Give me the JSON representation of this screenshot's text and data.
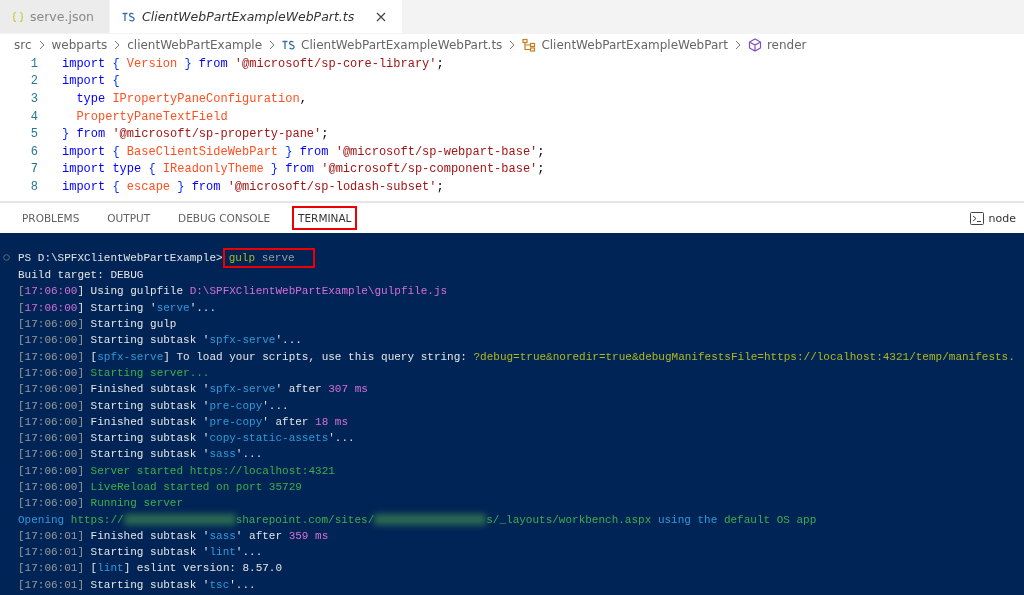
{
  "editor_tabs": [
    {
      "label": "serve.json",
      "kind": "json",
      "selected": false,
      "italic": false,
      "closable": false
    },
    {
      "label": "ClientWebPartExampleWebPart.ts",
      "kind": "ts",
      "selected": true,
      "italic": true,
      "closable": true
    }
  ],
  "breadcrumb": [
    {
      "label": "src",
      "kind": "folder"
    },
    {
      "label": "webparts",
      "kind": "folder"
    },
    {
      "label": "clientWebPartExample",
      "kind": "folder"
    },
    {
      "label": "ClientWebPartExampleWebPart.ts",
      "kind": "ts"
    },
    {
      "label": "ClientWebPartExampleWebPart",
      "kind": "class"
    },
    {
      "label": "render",
      "kind": "method"
    }
  ],
  "code_lines": [
    {
      "number": "1",
      "segments": [
        {
          "text": "import",
          "kind": "keyword"
        },
        {
          "text": " {",
          "kind": "brace"
        },
        {
          "text": " Version ",
          "kind": "ident"
        },
        {
          "text": "}",
          "kind": "brace"
        },
        {
          "text": " from ",
          "kind": "keyword"
        },
        {
          "text": "'@microsoft/sp-core-library'",
          "kind": "string"
        },
        {
          "text": ";",
          "kind": "plain"
        }
      ]
    },
    {
      "number": "2",
      "segments": [
        {
          "text": "import",
          "kind": "keyword"
        },
        {
          "text": " {",
          "kind": "brace"
        }
      ]
    },
    {
      "number": "3",
      "segments": [
        {
          "text": "  type",
          "kind": "keyword"
        },
        {
          "text": " IPropertyPaneConfiguration",
          "kind": "ident"
        },
        {
          "text": ",",
          "kind": "plain"
        }
      ]
    },
    {
      "number": "4",
      "segments": [
        {
          "text": "  PropertyPaneTextField",
          "kind": "ident"
        }
      ]
    },
    {
      "number": "5",
      "segments": [
        {
          "text": "}",
          "kind": "brace"
        },
        {
          "text": " from ",
          "kind": "keyword"
        },
        {
          "text": "'@microsoft/sp-property-pane'",
          "kind": "string"
        },
        {
          "text": ";",
          "kind": "plain"
        }
      ]
    },
    {
      "number": "6",
      "segments": [
        {
          "text": "import",
          "kind": "keyword"
        },
        {
          "text": " {",
          "kind": "brace"
        },
        {
          "text": " BaseClientSideWebPart ",
          "kind": "ident"
        },
        {
          "text": "}",
          "kind": "brace"
        },
        {
          "text": " from ",
          "kind": "keyword"
        },
        {
          "text": "'@microsoft/sp-webpart-base'",
          "kind": "string"
        },
        {
          "text": ";",
          "kind": "plain"
        }
      ]
    },
    {
      "number": "7",
      "segments": [
        {
          "text": "import type",
          "kind": "keyword"
        },
        {
          "text": " {",
          "kind": "brace"
        },
        {
          "text": " IReadonlyTheme ",
          "kind": "ident"
        },
        {
          "text": "}",
          "kind": "brace"
        },
        {
          "text": " from ",
          "kind": "keyword"
        },
        {
          "text": "'@microsoft/sp-component-base'",
          "kind": "string"
        },
        {
          "text": ";",
          "kind": "plain"
        }
      ]
    },
    {
      "number": "8",
      "segments": [
        {
          "text": "import",
          "kind": "keyword"
        },
        {
          "text": " {",
          "kind": "brace"
        },
        {
          "text": " escape ",
          "kind": "ident"
        },
        {
          "text": "}",
          "kind": "brace"
        },
        {
          "text": " from ",
          "kind": "keyword"
        },
        {
          "text": "'@microsoft/sp-lodash-subset'",
          "kind": "string"
        },
        {
          "text": ";",
          "kind": "plain"
        }
      ]
    }
  ],
  "panel_tabs": [
    {
      "label": "PROBLEMS",
      "selected": false,
      "highlighted": false
    },
    {
      "label": "OUTPUT",
      "selected": false,
      "highlighted": false
    },
    {
      "label": "DEBUG CONSOLE",
      "selected": false,
      "highlighted": false
    },
    {
      "label": "TERMINAL",
      "selected": true,
      "highlighted": true
    }
  ],
  "terminal_profile": {
    "label": "node"
  },
  "terminal": {
    "prompt": "PS D:\\SPFXClientWebPartExample>",
    "command": [
      {
        "text": "gulp",
        "kind": "yellow"
      },
      {
        "text": " serve",
        "kind": "gray"
      }
    ],
    "command_highlighted": true,
    "lines": [
      [
        {
          "text": "Build target: DEBUG",
          "kind": "plain"
        }
      ],
      [
        {
          "text": "[",
          "kind": "gray"
        },
        {
          "text": "17:06:00",
          "kind": "magenta"
        },
        {
          "text": "] Using gulpfile ",
          "kind": "plain"
        },
        {
          "text": "D:\\SPFXClientWebPartExample\\gulpfile.js",
          "kind": "magenta"
        }
      ],
      [
        {
          "text": "[",
          "kind": "gray"
        },
        {
          "text": "17:06:00",
          "kind": "magenta"
        },
        {
          "text": "] Starting '",
          "kind": "plain"
        },
        {
          "text": "serve",
          "kind": "cyan"
        },
        {
          "text": "'...",
          "kind": "plain"
        }
      ],
      [
        {
          "text": "[17:06:00]",
          "kind": "gray"
        },
        {
          "text": " Starting gulp",
          "kind": "plain"
        }
      ],
      [
        {
          "text": "[17:06:00]",
          "kind": "gray"
        },
        {
          "text": " Starting subtask '",
          "kind": "plain"
        },
        {
          "text": "spfx-serve",
          "kind": "cyan"
        },
        {
          "text": "'...",
          "kind": "plain"
        }
      ],
      [
        {
          "text": "[17:06:00]",
          "kind": "gray"
        },
        {
          "text": " [",
          "kind": "plain"
        },
        {
          "text": "spfx-serve",
          "kind": "cyan"
        },
        {
          "text": "] To load your scripts, use this query string: ",
          "kind": "plain"
        },
        {
          "text": "?debug=true&noredir=true&debugManifestsFile=https://localhost:4321/temp/manifests.",
          "kind": "yellow"
        }
      ],
      [
        {
          "text": "[17:06:00]",
          "kind": "gray"
        },
        {
          "text": " Starting server...",
          "kind": "green"
        }
      ],
      [
        {
          "text": "[17:06:00]",
          "kind": "gray"
        },
        {
          "text": " Finished subtask '",
          "kind": "plain"
        },
        {
          "text": "spfx-serve",
          "kind": "cyan"
        },
        {
          "text": "' after ",
          "kind": "plain"
        },
        {
          "text": "307 ms",
          "kind": "magenta"
        }
      ],
      [
        {
          "text": "[17:06:00]",
          "kind": "gray"
        },
        {
          "text": " Starting subtask '",
          "kind": "plain"
        },
        {
          "text": "pre-copy",
          "kind": "cyan"
        },
        {
          "text": "'...",
          "kind": "plain"
        }
      ],
      [
        {
          "text": "[17:06:00]",
          "kind": "gray"
        },
        {
          "text": " Finished subtask '",
          "kind": "plain"
        },
        {
          "text": "pre-copy",
          "kind": "cyan"
        },
        {
          "text": "' after ",
          "kind": "plain"
        },
        {
          "text": "18 ms",
          "kind": "magenta"
        }
      ],
      [
        {
          "text": "[17:06:00]",
          "kind": "gray"
        },
        {
          "text": " Starting subtask '",
          "kind": "plain"
        },
        {
          "text": "copy-static-assets",
          "kind": "cyan"
        },
        {
          "text": "'...",
          "kind": "plain"
        }
      ],
      [
        {
          "text": "[17:06:00]",
          "kind": "gray"
        },
        {
          "text": " Starting subtask '",
          "kind": "plain"
        },
        {
          "text": "sass",
          "kind": "cyan"
        },
        {
          "text": "'...",
          "kind": "plain"
        }
      ],
      [
        {
          "text": "[17:06:00]",
          "kind": "gray"
        },
        {
          "text": " Server started https://localhost:4321",
          "kind": "green"
        }
      ],
      [
        {
          "text": "[17:06:00]",
          "kind": "gray"
        },
        {
          "text": " LiveReload started on port 35729",
          "kind": "green"
        }
      ],
      [
        {
          "text": "[17:06:00]",
          "kind": "gray"
        },
        {
          "text": " Running server",
          "kind": "green"
        }
      ],
      [
        {
          "text": "Opening ",
          "kind": "cyan"
        },
        {
          "text": "https://",
          "kind": "green"
        },
        {
          "kind": "redacted"
        },
        {
          "text": "sharepoint.com/sites/",
          "kind": "green"
        },
        {
          "kind": "redacted"
        },
        {
          "text": "s/_layouts/workbench.aspx",
          "kind": "green"
        },
        {
          "text": " using the ",
          "kind": "cyan"
        },
        {
          "text": "default OS app",
          "kind": "green"
        }
      ],
      [
        {
          "text": "[17:06:01]",
          "kind": "gray"
        },
        {
          "text": " Finished subtask '",
          "kind": "plain"
        },
        {
          "text": "sass",
          "kind": "cyan"
        },
        {
          "text": "' after ",
          "kind": "plain"
        },
        {
          "text": "359 ms",
          "kind": "magenta"
        }
      ],
      [
        {
          "text": "[17:06:01]",
          "kind": "gray"
        },
        {
          "text": " Starting subtask '",
          "kind": "plain"
        },
        {
          "text": "lint",
          "kind": "cyan"
        },
        {
          "text": "'...",
          "kind": "plain"
        }
      ],
      [
        {
          "text": "[17:06:01]",
          "kind": "gray"
        },
        {
          "text": " [",
          "kind": "plain"
        },
        {
          "text": "lint",
          "kind": "cyan"
        },
        {
          "text": "] eslint version: 8.57.0",
          "kind": "plain"
        }
      ],
      [
        {
          "text": "[17:06:01]",
          "kind": "gray"
        },
        {
          "text": " Starting subtask '",
          "kind": "plain"
        },
        {
          "text": "tsc",
          "kind": "cyan"
        },
        {
          "text": "'...",
          "kind": "plain"
        }
      ]
    ]
  }
}
